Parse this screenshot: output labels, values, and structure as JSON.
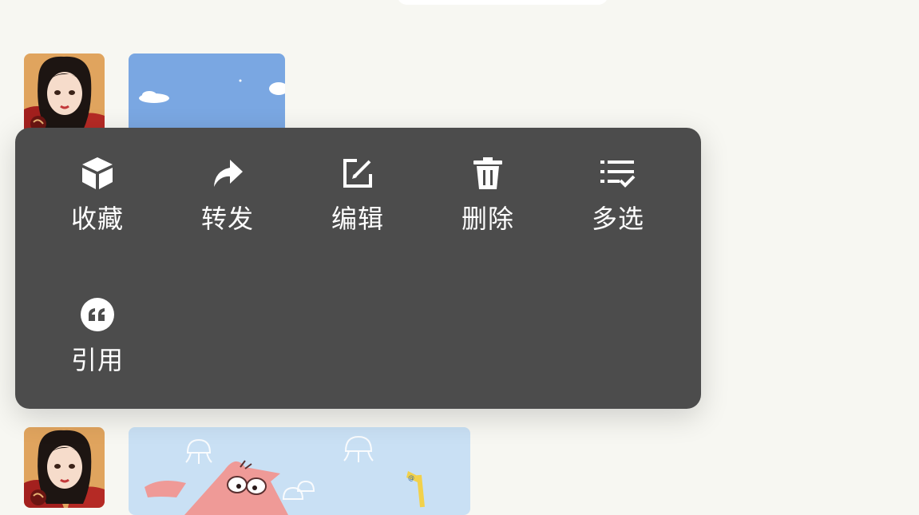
{
  "context_menu": {
    "items": [
      {
        "label": "收藏",
        "icon": "cube-icon"
      },
      {
        "label": "转发",
        "icon": "share-arrow-icon"
      },
      {
        "label": "编辑",
        "icon": "edit-icon"
      },
      {
        "label": "删除",
        "icon": "trash-icon"
      },
      {
        "label": "多选",
        "icon": "multi-select-icon"
      },
      {
        "label": "引用",
        "icon": "quote-icon"
      }
    ]
  },
  "colors": {
    "background": "#f7f7f2",
    "menu_background": "#4c4c4c",
    "menu_text": "#ffffff",
    "sky_blue": "#7aa7e2"
  }
}
